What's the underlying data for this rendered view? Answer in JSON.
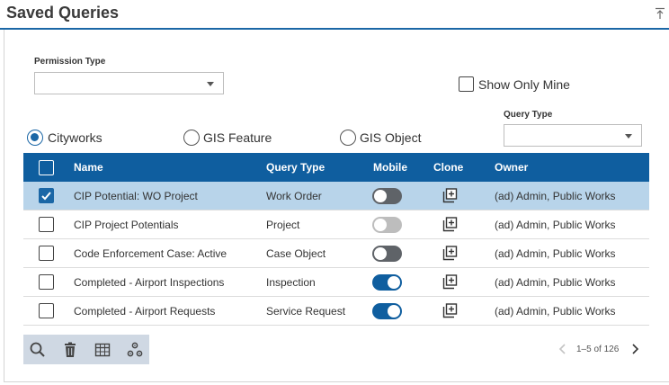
{
  "panel": {
    "title": "Saved Queries"
  },
  "filters": {
    "permission_type_label": "Permission Type",
    "permission_type_value": "",
    "show_only_mine_label": "Show Only Mine",
    "query_type_label": "Query Type",
    "query_type_value": ""
  },
  "source_options": [
    {
      "label": "Cityworks",
      "checked": true
    },
    {
      "label": "GIS Feature",
      "checked": false
    },
    {
      "label": "GIS Object",
      "checked": false
    }
  ],
  "grid": {
    "columns": {
      "name": "Name",
      "query_type": "Query Type",
      "mobile": "Mobile",
      "clone": "Clone",
      "owner": "Owner"
    },
    "rows": [
      {
        "name": "CIP Potential: WO Project",
        "query_type": "Work Order",
        "mobile": "off",
        "owner": "(ad) Admin, Public Works",
        "selected": true
      },
      {
        "name": "CIP Project Potentials",
        "query_type": "Project",
        "mobile": "disabled",
        "owner": "(ad) Admin, Public Works",
        "selected": false
      },
      {
        "name": "Code Enforcement Case: Active",
        "query_type": "Case Object",
        "mobile": "off",
        "owner": "(ad) Admin, Public Works",
        "selected": false
      },
      {
        "name": "Completed - Airport Inspections",
        "query_type": "Inspection",
        "mobile": "on",
        "owner": "(ad) Admin, Public Works",
        "selected": false
      },
      {
        "name": "Completed - Airport Requests",
        "query_type": "Service Request",
        "mobile": "on",
        "owner": "(ad) Admin, Public Works",
        "selected": false
      }
    ]
  },
  "toolbar": {
    "icons": [
      "search-icon",
      "trash-icon",
      "table-icon",
      "settings-icon"
    ]
  },
  "pager": {
    "text": "1–5 of 126"
  },
  "colors": {
    "accent": "#0f5e9f",
    "selected_row": "#b8d4ea",
    "toolbar_bg": "#cfd8e3"
  }
}
